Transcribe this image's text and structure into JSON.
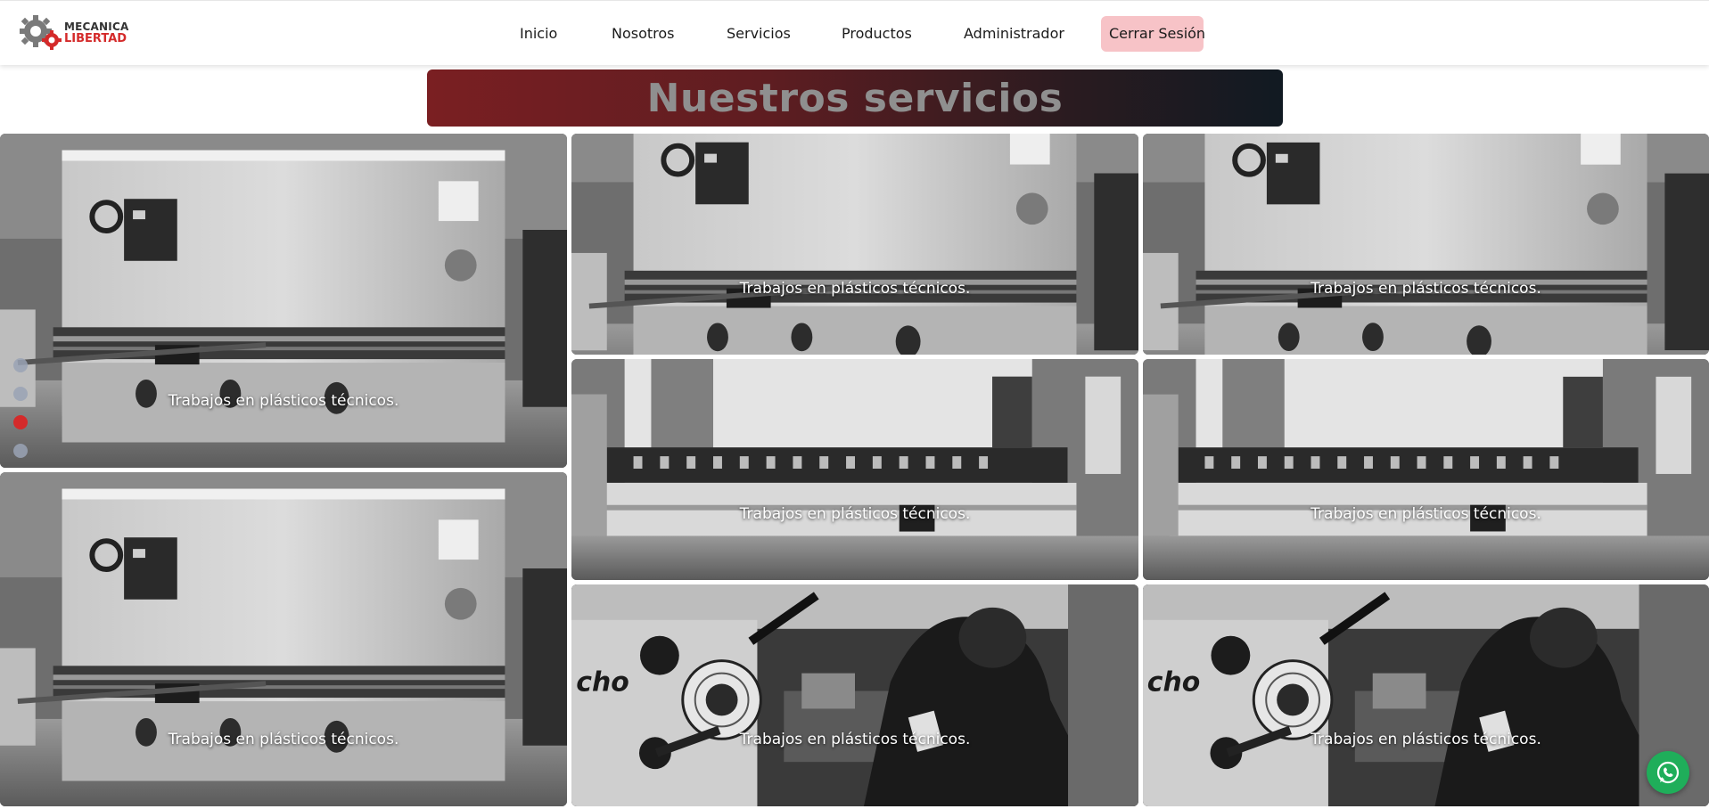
{
  "brand": {
    "line1": "MECANICA",
    "line2": "LIBERTAD",
    "logo_icon": "gear-logo-icon"
  },
  "nav": {
    "items": [
      {
        "label": "Inicio"
      },
      {
        "label": "Nosotros"
      },
      {
        "label": "Servicios"
      },
      {
        "label": "Productos"
      },
      {
        "label": "Administrador"
      },
      {
        "label": "Cerrar Sesión"
      }
    ]
  },
  "main": {
    "title": "Nuestros servicios",
    "tiles": [
      {
        "caption": "Trabajos en plásticos técnicos.",
        "photo": "shear-machine"
      },
      {
        "caption": "Trabajos en plásticos técnicos.",
        "photo": "shear-machine"
      },
      {
        "caption": "Trabajos en plásticos técnicos.",
        "photo": "shear-machine"
      },
      {
        "caption": "Trabajos en plásticos técnicos.",
        "photo": "shear-machine"
      },
      {
        "caption": "Trabajos en plásticos técnicos.",
        "photo": "press-brake"
      },
      {
        "caption": "Trabajos en plásticos técnicos.",
        "photo": "press-brake"
      },
      {
        "caption": "Trabajos en plásticos técnicos.",
        "photo": "lathe-operator"
      },
      {
        "caption": "Trabajos en plásticos técnicos.",
        "photo": "lathe-operator"
      }
    ],
    "carousel": {
      "count": 4,
      "active_index": 2
    }
  },
  "whatsapp": {
    "icon": "whatsapp-icon"
  },
  "colors": {
    "accent": "#d42a2a",
    "logout_bg": "#f7c3c7",
    "banner_start": "#7a1f22",
    "banner_end": "#111a22",
    "whatsapp": "#1fae5a"
  }
}
